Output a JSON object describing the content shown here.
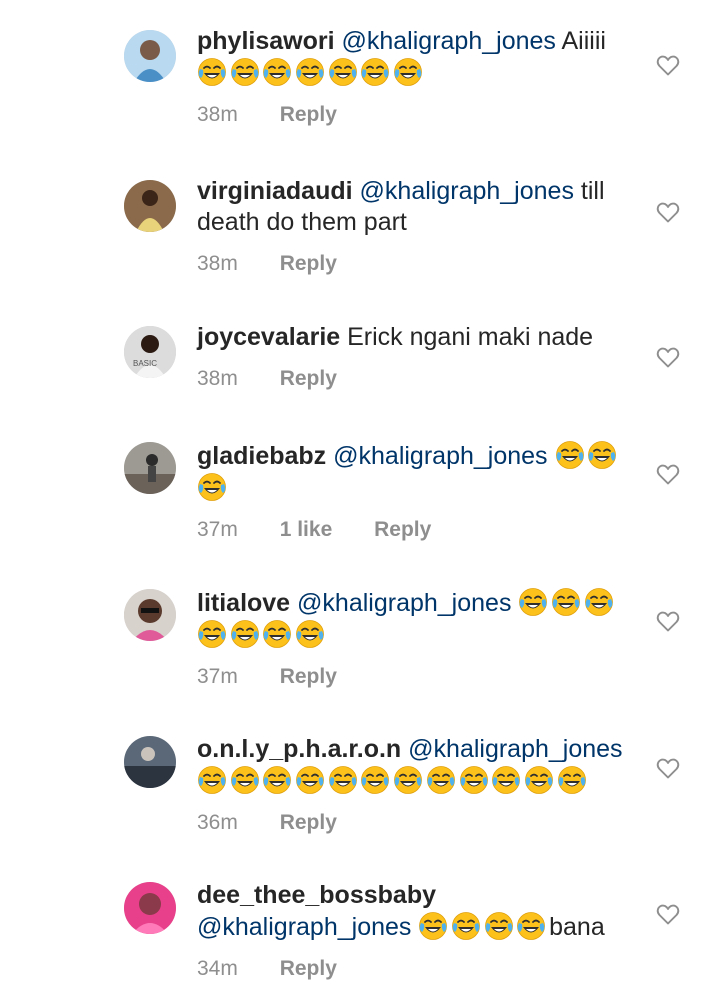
{
  "comments": [
    {
      "username": "phylisawori",
      "mention": "@khaligraph_jones",
      "text": "Aiiiii",
      "emojis_line1": 0,
      "emojis_line2": 7,
      "time": "38m",
      "likes": "",
      "reply": "Reply"
    },
    {
      "username": "virginiadaudi",
      "mention": "@khaligraph_jones",
      "text": "till death do them part",
      "time": "38m",
      "likes": "",
      "reply": "Reply"
    },
    {
      "username": "joycevalarie",
      "mention": "",
      "text": "Erick ngani maki nade",
      "time": "38m",
      "likes": "",
      "reply": "Reply"
    },
    {
      "username": "gladiebabz",
      "mention": "@khaligraph_jones",
      "text": "",
      "emoji_count": 3,
      "time": "37m",
      "likes": "1 like",
      "reply": "Reply"
    },
    {
      "username": "litialove",
      "mention": "@khaligraph_jones",
      "text": "",
      "emoji_count": 7,
      "time": "37m",
      "likes": "",
      "reply": "Reply"
    },
    {
      "username": "o.n.l.y_p.h.a.r.o.n",
      "mention": "@khaligraph_jones",
      "text": "",
      "emoji_count": 12,
      "time": "36m",
      "likes": "",
      "reply": "Reply"
    },
    {
      "username": "dee_thee_bossbaby",
      "mention": "@khaligraph_jones",
      "text": "bana",
      "emoji_count": 4,
      "time": "34m",
      "likes": "",
      "reply": "Reply"
    }
  ],
  "emoji_name": "face-with-tears-of-joy",
  "colors": {
    "username": "#262626",
    "mention": "#003569",
    "meta": "#8e8e8e"
  }
}
